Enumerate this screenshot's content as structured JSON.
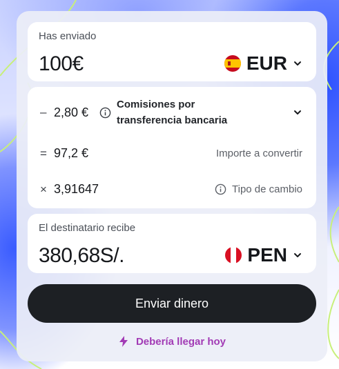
{
  "send": {
    "label": "Has enviado",
    "amount": "100€",
    "currency_code": "EUR",
    "flag_icon": "spain-flag-icon"
  },
  "fees": {
    "fee_operator": "–",
    "fee_value": "2,80 €",
    "fee_title": "Comisiones por transferencia bancaria",
    "converted_operator": "=",
    "converted_value": "97,2 €",
    "converted_desc": "Importe a convertir",
    "rate_operator": "×",
    "rate_value": "3,91647",
    "rate_desc": "Tipo de cambio"
  },
  "receive": {
    "label": "El destinatario recibe",
    "amount": "380,68S/.",
    "currency_code": "PEN",
    "flag_icon": "peru-flag-icon"
  },
  "action": {
    "send_button_label": "Enviar dinero"
  },
  "eta": {
    "text": "Debería llegar hoy",
    "icon": "lightning-icon",
    "color": "#a23bb5"
  },
  "colors": {
    "button_bg": "#1d2024",
    "card_bg": "#eceef8",
    "accent_background": "#3a5cff"
  }
}
